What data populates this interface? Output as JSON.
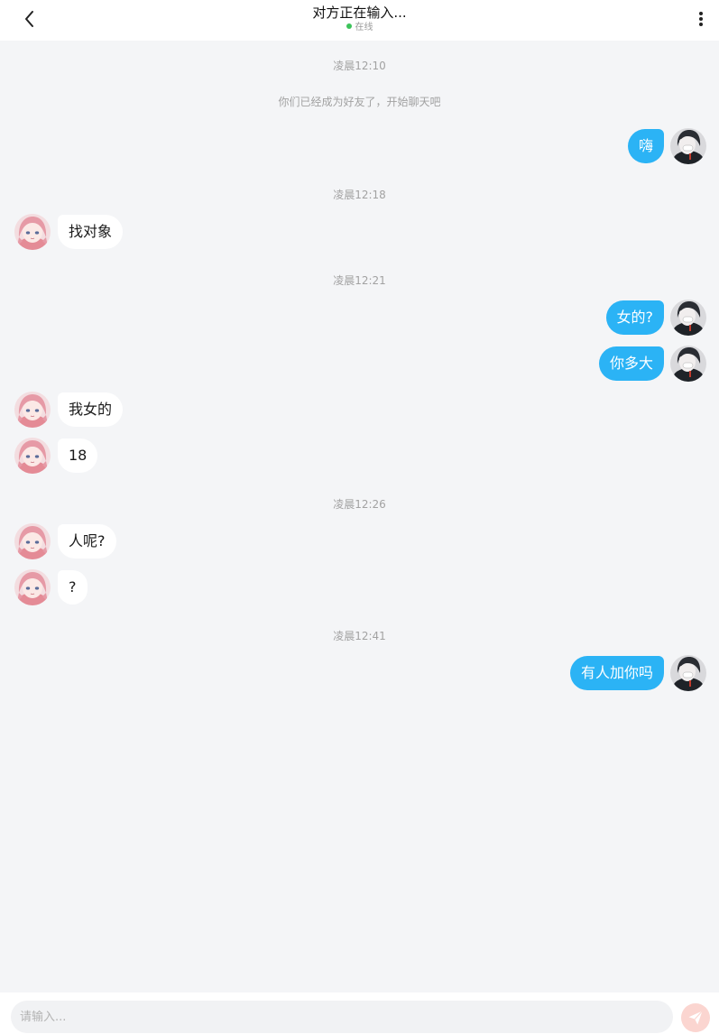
{
  "header": {
    "title": "对方正在输入...",
    "status": "在线",
    "back_icon": "chevron-left-icon",
    "more_icon": "more-vertical-icon"
  },
  "messages": {
    "t1": "凌晨12:10",
    "system": "你们已经成为好友了，开始聊天吧",
    "m1": "嗨",
    "t2": "凌晨12:18",
    "m2": "找对象",
    "t3": "凌晨12:21",
    "m3": "女的?",
    "m4": "你多大",
    "m5": "我女的",
    "m6": "18",
    "t4": "凌晨12:26",
    "m7": "人呢?",
    "m8": "?",
    "t5": "凌晨12:41",
    "m9": "有人加你吗"
  },
  "composer": {
    "placeholder": "请输入...",
    "send_icon": "paper-plane-icon"
  },
  "colors": {
    "sent_bubble": "#2bb3f5",
    "received_bubble": "#ffffff",
    "background": "#f4f5f7",
    "online_dot": "#3cc35a",
    "send_button": "#fbd5d0"
  }
}
